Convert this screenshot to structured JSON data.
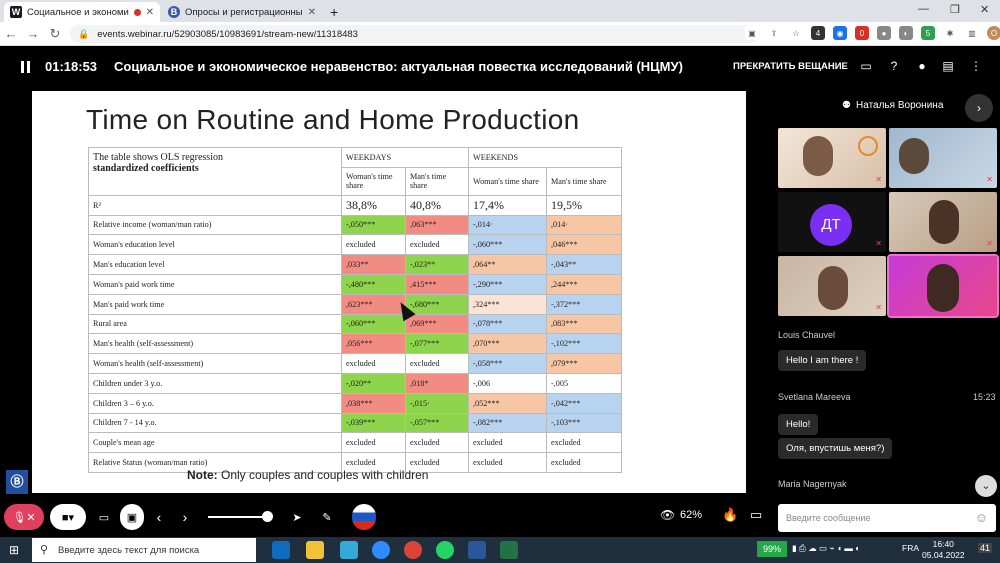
{
  "browser": {
    "tabs": [
      {
        "title": "Социальное и экономическ",
        "favicon": "W",
        "color": "#1a1a1a"
      },
      {
        "title": "Опросы и регистрационные ф",
        "favicon": "B",
        "color": "#3b5aa8"
      }
    ],
    "url": "events.webinar.ru/52903085/10983691/stream-new/11318483",
    "profile_initial": "O",
    "extension_badge": "4",
    "extension_badge2": "5"
  },
  "webinar": {
    "timer": "01:18:53",
    "title": "Социальное и экономическое неравенство: актуальная повестка исследований (НЦМУ)",
    "stop_label": "ПРЕКРАТИТЬ ВЕЩАНИЕ"
  },
  "slide": {
    "title": "Time on Routine and Home Production",
    "intro_line1": "The table shows OLS regression",
    "intro_line2": "standardized coefficients",
    "group_weekdays": "WEEKDAYS",
    "group_weekends": "WEEKENDS",
    "col_headers": [
      "Woman's time share",
      "Man's time share",
      "Woman's time share",
      "Man's time share"
    ],
    "r2_label": "R²",
    "r2_values": [
      "38,8%",
      "40,8%",
      "17,4%",
      "19,5%"
    ],
    "rows": [
      {
        "label": "Relative income (woman/man ratio)",
        "cells": [
          [
            "-,050***",
            "g"
          ],
          [
            ",063***",
            "r"
          ],
          [
            "-,014·",
            "b"
          ],
          [
            ",014·",
            "o"
          ]
        ]
      },
      {
        "label": "Woman's education level",
        "cells": [
          [
            "excluded",
            "w"
          ],
          [
            "excluded",
            "w"
          ],
          [
            "-,060***",
            "b"
          ],
          [
            ",046***",
            "o"
          ]
        ]
      },
      {
        "label": "Man's education level",
        "cells": [
          [
            ",033**",
            "r"
          ],
          [
            "-,023**",
            "g"
          ],
          [
            ",064**",
            "o"
          ],
          [
            "-,043**",
            "b"
          ]
        ]
      },
      {
        "label": "Woman's paid work time",
        "cells": [
          [
            "-,480***",
            "g"
          ],
          [
            ",415***",
            "r"
          ],
          [
            "-,290***",
            "b"
          ],
          [
            ",244***",
            "o"
          ]
        ]
      },
      {
        "label": "Man's paid work time",
        "cells": [
          [
            ",623***",
            "r"
          ],
          [
            "-,680***",
            "g"
          ],
          [
            ",324***",
            "pk"
          ],
          [
            "-,372***",
            "b"
          ]
        ]
      },
      {
        "label": "Rural area",
        "cells": [
          [
            "-,060***",
            "g"
          ],
          [
            ",069***",
            "r"
          ],
          [
            "-,078***",
            "b"
          ],
          [
            ",083***",
            "o"
          ]
        ]
      },
      {
        "label": "Man's health (self-assessment)",
        "cells": [
          [
            ",056***",
            "r"
          ],
          [
            "-,077***",
            "g"
          ],
          [
            ",070***",
            "o"
          ],
          [
            "-,102***",
            "b"
          ]
        ]
      },
      {
        "label": "Woman's health (self-assessment)",
        "cells": [
          [
            "excluded",
            "w"
          ],
          [
            "excluded",
            "w"
          ],
          [
            "-,058***",
            "b"
          ],
          [
            ",079***",
            "o"
          ]
        ]
      },
      {
        "label": "Children under 3 y.o.",
        "cells": [
          [
            "-,020**",
            "g"
          ],
          [
            ",018*",
            "r"
          ],
          [
            "-,006",
            "w"
          ],
          [
            "-,005",
            "w"
          ]
        ]
      },
      {
        "label": "Children 3 – 6 y.o.",
        "cells": [
          [
            ",038***",
            "r"
          ],
          [
            "-,015·",
            "g"
          ],
          [
            ",052***",
            "o"
          ],
          [
            "-,042***",
            "b"
          ]
        ]
      },
      {
        "label": "Children 7 - 14 y.o.",
        "cells": [
          [
            "-,039***",
            "g"
          ],
          [
            "-,057***",
            "g"
          ],
          [
            "-,082***",
            "b"
          ],
          [
            "-,103***",
            "b"
          ]
        ]
      },
      {
        "label": "Couple's mean age",
        "cells": [
          [
            "excluded",
            "w"
          ],
          [
            "excluded",
            "w"
          ],
          [
            "excluded",
            "w"
          ],
          [
            "excluded",
            "w"
          ]
        ]
      },
      {
        "label": "Relative Status (woman/man ratio)",
        "cells": [
          [
            "excluded",
            "w"
          ],
          [
            "excluded",
            "w"
          ],
          [
            "excluded",
            "w"
          ],
          [
            "excluded",
            "w"
          ]
        ]
      }
    ],
    "note_bold": "Note:",
    "note_text": " Only couples and couples with children"
  },
  "sidebar": {
    "host_name": "Наталья Воронина",
    "avatar_initials": "ДТ",
    "chat": [
      {
        "name": "Louis Chauvel",
        "time": "",
        "messages": [
          "Hello I am there !"
        ]
      },
      {
        "name": "Svetlana Mareeva",
        "time": "15:23",
        "messages": [
          "Hello!",
          "Оля, впустишь меня?)"
        ]
      },
      {
        "name": "Maria Nagernyak",
        "time": "",
        "messages": []
      }
    ],
    "message_placeholder": "Введите сообщение"
  },
  "controls": {
    "zoom": "62%"
  },
  "taskbar": {
    "search_placeholder": "Введите здесь текст для поиска",
    "battery": "99%",
    "language": "FRA",
    "time": "16:40",
    "date": "05.04.2022",
    "notifications": "41"
  }
}
